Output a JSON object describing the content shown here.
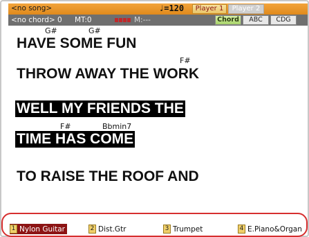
{
  "header": {
    "song": "<no song>",
    "tempo": "♩=120",
    "player1": "Player 1",
    "player2": "Player 2",
    "chord_info": "<no chord> 0",
    "mt": "MT:0",
    "m_value": "M:---",
    "tab_chord": "Chord",
    "tab_abc": "ABC",
    "tab_cdg": "CDG"
  },
  "lyrics": {
    "lines": [
      "HAVE SOME FUN",
      "THROW AWAY THE WORK",
      "WELL MY FRIENDS THE",
      "TIME HAS COME",
      "TO RAISE THE ROOF AND"
    ],
    "chords": [
      "G#",
      "G#",
      "F#",
      "F#",
      "Bbmin7"
    ]
  },
  "tracks": [
    {
      "num": "1",
      "label": "Nylon Guitar"
    },
    {
      "num": "2",
      "label": "Dist.Gtr"
    },
    {
      "num": "3",
      "label": "Trumpet"
    },
    {
      "num": "4",
      "label": "E.Piano&Organ"
    }
  ],
  "colors": {
    "header_orange": "#e8961f",
    "header_gray": "#6f6f6f",
    "selected_track": "#8c1414",
    "highlight_oval": "#d62f2f"
  }
}
